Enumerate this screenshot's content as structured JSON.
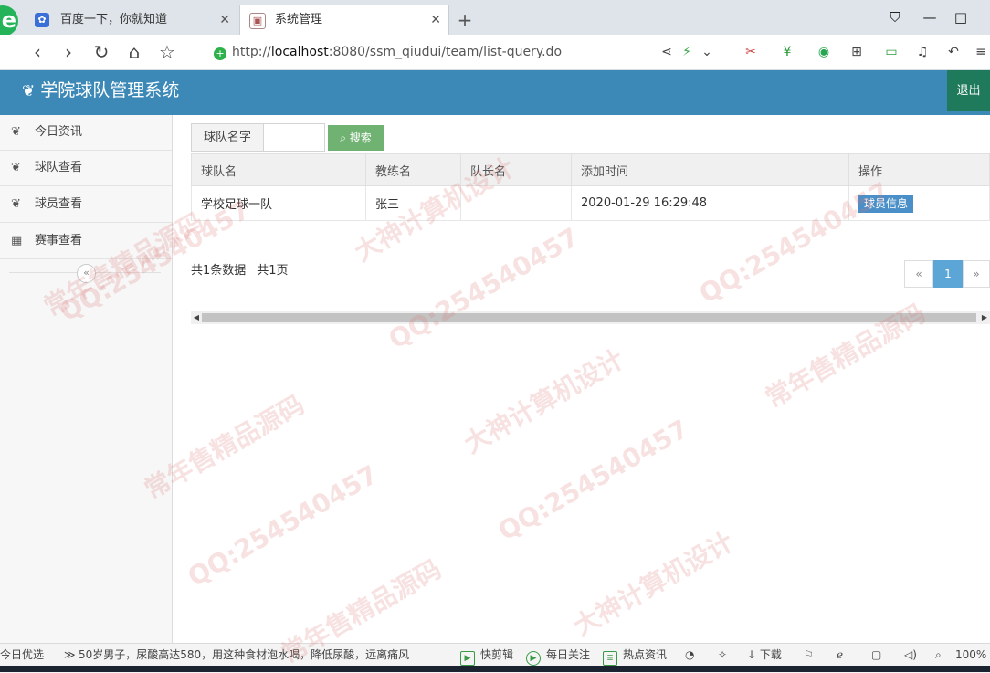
{
  "browser": {
    "tabs": [
      {
        "title": "百度一下，你就知道",
        "icon": "paw-icon"
      },
      {
        "title": "系统管理",
        "icon": "page-icon",
        "active": true
      }
    ],
    "address": {
      "scheme": "http://",
      "host": "localhost",
      "rest": ":8080/ssm_qiudui/team/list-query.do"
    }
  },
  "app": {
    "title": "学院球队管理系统",
    "logout": "退出"
  },
  "sidebar": {
    "items": [
      {
        "label": "今日资讯",
        "icon": "leaf-icon"
      },
      {
        "label": "球队查看",
        "icon": "leaf-icon"
      },
      {
        "label": "球员查看",
        "icon": "leaf-icon"
      },
      {
        "label": "赛事查看",
        "icon": "calendar-icon"
      }
    ],
    "collapse": "«"
  },
  "search": {
    "label": "球队名字",
    "value": "",
    "button": "搜索"
  },
  "table": {
    "headers": [
      "球队名",
      "教练名",
      "队长名",
      "添加时间",
      "操作"
    ],
    "rows": [
      {
        "team": "学校足球一队",
        "coach": "张三",
        "captain": "",
        "added": "2020-01-29 16:29:48",
        "action": "球员信息"
      }
    ]
  },
  "summary": {
    "records": "共1条数据",
    "pages": "共1页"
  },
  "pagination": {
    "prev": "«",
    "current": "1",
    "next": "»"
  },
  "statusbar": {
    "left": "今日优选",
    "news": "50岁男子，尿酸高达580，用这种食材泡水喝，降低尿酸，远离痛风",
    "items": [
      "快剪辑",
      "每日关注",
      "热点资讯",
      "下载"
    ],
    "zoom": "100%"
  },
  "watermark": [
    "QQ:254540457",
    "常年售精品源码",
    "大神计算机设计"
  ]
}
